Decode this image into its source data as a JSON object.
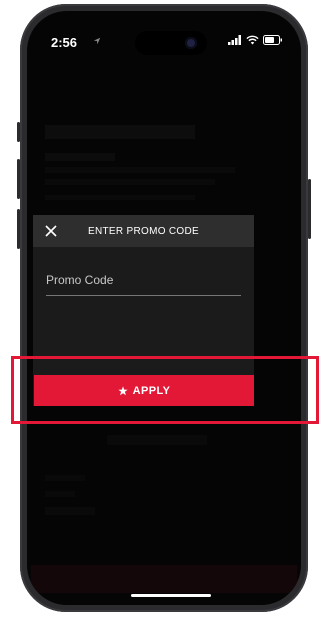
{
  "status_bar": {
    "time": "2:56"
  },
  "modal": {
    "title": "ENTER PROMO CODE",
    "promo_placeholder": "Promo Code",
    "promo_value": ""
  },
  "apply_button": {
    "label": "APPLY"
  },
  "colors": {
    "accent": "#e31837",
    "modal_bg": "#1b1b1b",
    "modal_header_bg": "#2e2e2e"
  },
  "icons": {
    "close": "close-icon",
    "star": "star-icon",
    "location": "location-arrow-icon"
  }
}
